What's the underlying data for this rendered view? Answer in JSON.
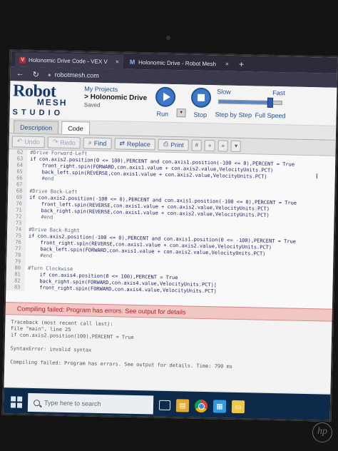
{
  "browser": {
    "tabs": [
      {
        "title": "Holonomic Drive Code - VEX V",
        "icon": "vex-icon",
        "active": true
      },
      {
        "title": "Holonomic Drive - Robot Mesh",
        "icon": "robotmesh-icon",
        "active": false
      }
    ],
    "close_glyph": "×",
    "new_tab_glyph": "+",
    "back_glyph": "←",
    "reload_glyph": "↻",
    "url": "robotmesh.com"
  },
  "app": {
    "logo_top": "Robot",
    "logo_mid": "MESH",
    "logo_bottom": "STUDIO",
    "project_crumb": "My Projects",
    "project_name": "> Holonomic Drive",
    "project_status": "Saved",
    "run_label": "Run",
    "run_dropdown": "▾",
    "stop_label": "Stop",
    "speed_slow": "Slow",
    "speed_fast": "Fast",
    "speed_value": 0.82,
    "step_label": "Step by Step",
    "full_speed_label": "Full Speed"
  },
  "tabs": {
    "description": "Description",
    "code": "Code"
  },
  "toolbar": {
    "undo": "Undo",
    "redo": "Redo",
    "find": "Find",
    "replace": "Replace",
    "print": "Print",
    "comment": "#",
    "outdent": "«",
    "indent": "»",
    "more": "▾"
  },
  "code_lines": [
    {
      "n": "62",
      "t": "#Drive Forward-Left",
      "c": true
    },
    {
      "n": "63",
      "t": "if con.axis2.position(0 <= 100),PERCENT and con.axis1.position(-100 <= 0),PERCENT = True"
    },
    {
      "n": "64",
      "t": "    front_right.spin(FORWARD,con.axis1.value + con.axis2.value,VelocityUnits.PCT)"
    },
    {
      "n": "65",
      "t": "    back_left.spin(REVERSE,con.axis1.value + con.axis2.value,VelocityUnits.PCT)"
    },
    {
      "n": "66",
      "t": "    #end",
      "c": true
    },
    {
      "n": "67",
      "t": ""
    },
    {
      "n": "68",
      "t": "#Drive Back-Left",
      "c": true
    },
    {
      "n": "69",
      "t": "if con.axis2.position(-100 <= 0),PERCENT and con.axis1.position(-100 <= 0),PERCENT = True"
    },
    {
      "n": "70",
      "t": "    front_left.spin(REVERSE,con.axis1.value + con.axis2.value,VelocityUnits.PCT)"
    },
    {
      "n": "71",
      "t": "    back_right.spin(REVERSE,con.axis1.value + con.axis2.value,VelocityUnits.PCT)"
    },
    {
      "n": "72",
      "t": "    #end",
      "c": true
    },
    {
      "n": "73",
      "t": ""
    },
    {
      "n": "74",
      "t": "#Drive Back-Right",
      "c": true
    },
    {
      "n": "75",
      "t": "if con.axis2.position(-100 <= 0),PERCENT and con.axis1.position(0 <= -100),PERCENT = True"
    },
    {
      "n": "76",
      "t": "    front_right.spin(REVERSE,con.axis1.value + con.axis2.value,VelocityUnits.PCT)"
    },
    {
      "n": "77",
      "t": "    back_left.spin(FORWARD,con.axis1.value + con.axis2.value,VelocityUnits.PCT)"
    },
    {
      "n": "78",
      "t": "    #end",
      "c": true
    },
    {
      "n": "79",
      "t": ""
    },
    {
      "n": "80",
      "t": "#Turn Clockwise",
      "c": true
    },
    {
      "n": "81",
      "t": "    if con.axis4.position(0 <= 100),PERCENT = True"
    },
    {
      "n": "82",
      "t": "    back_right.spin(FORWARD,con.axis4.value,VelocityUnits.PCT)|"
    },
    {
      "n": "83",
      "t": "    front_right.spin(FORWARD,con.axis4.value,VelocityUnits.PCT)"
    }
  ],
  "error_banner": "Compiling failed: Program has errors. See output for details",
  "console_lines": [
    {
      "t": "Traceback (most recent call last):"
    },
    {
      "t": "File \"main\", line 25"
    },
    {
      "t": "if con.axis2.position(100),PERCENT = True"
    },
    {
      "t": "",
      "gap": true
    },
    {
      "t": "SyntaxError: invalid syntax"
    },
    {
      "t": "",
      "gap": true
    },
    {
      "t": "Compiling failed: Program has errors. See output for details. Time: 790 ms"
    }
  ],
  "taskbar": {
    "search_placeholder": "Type here to search"
  },
  "bezel_brand": "hp"
}
